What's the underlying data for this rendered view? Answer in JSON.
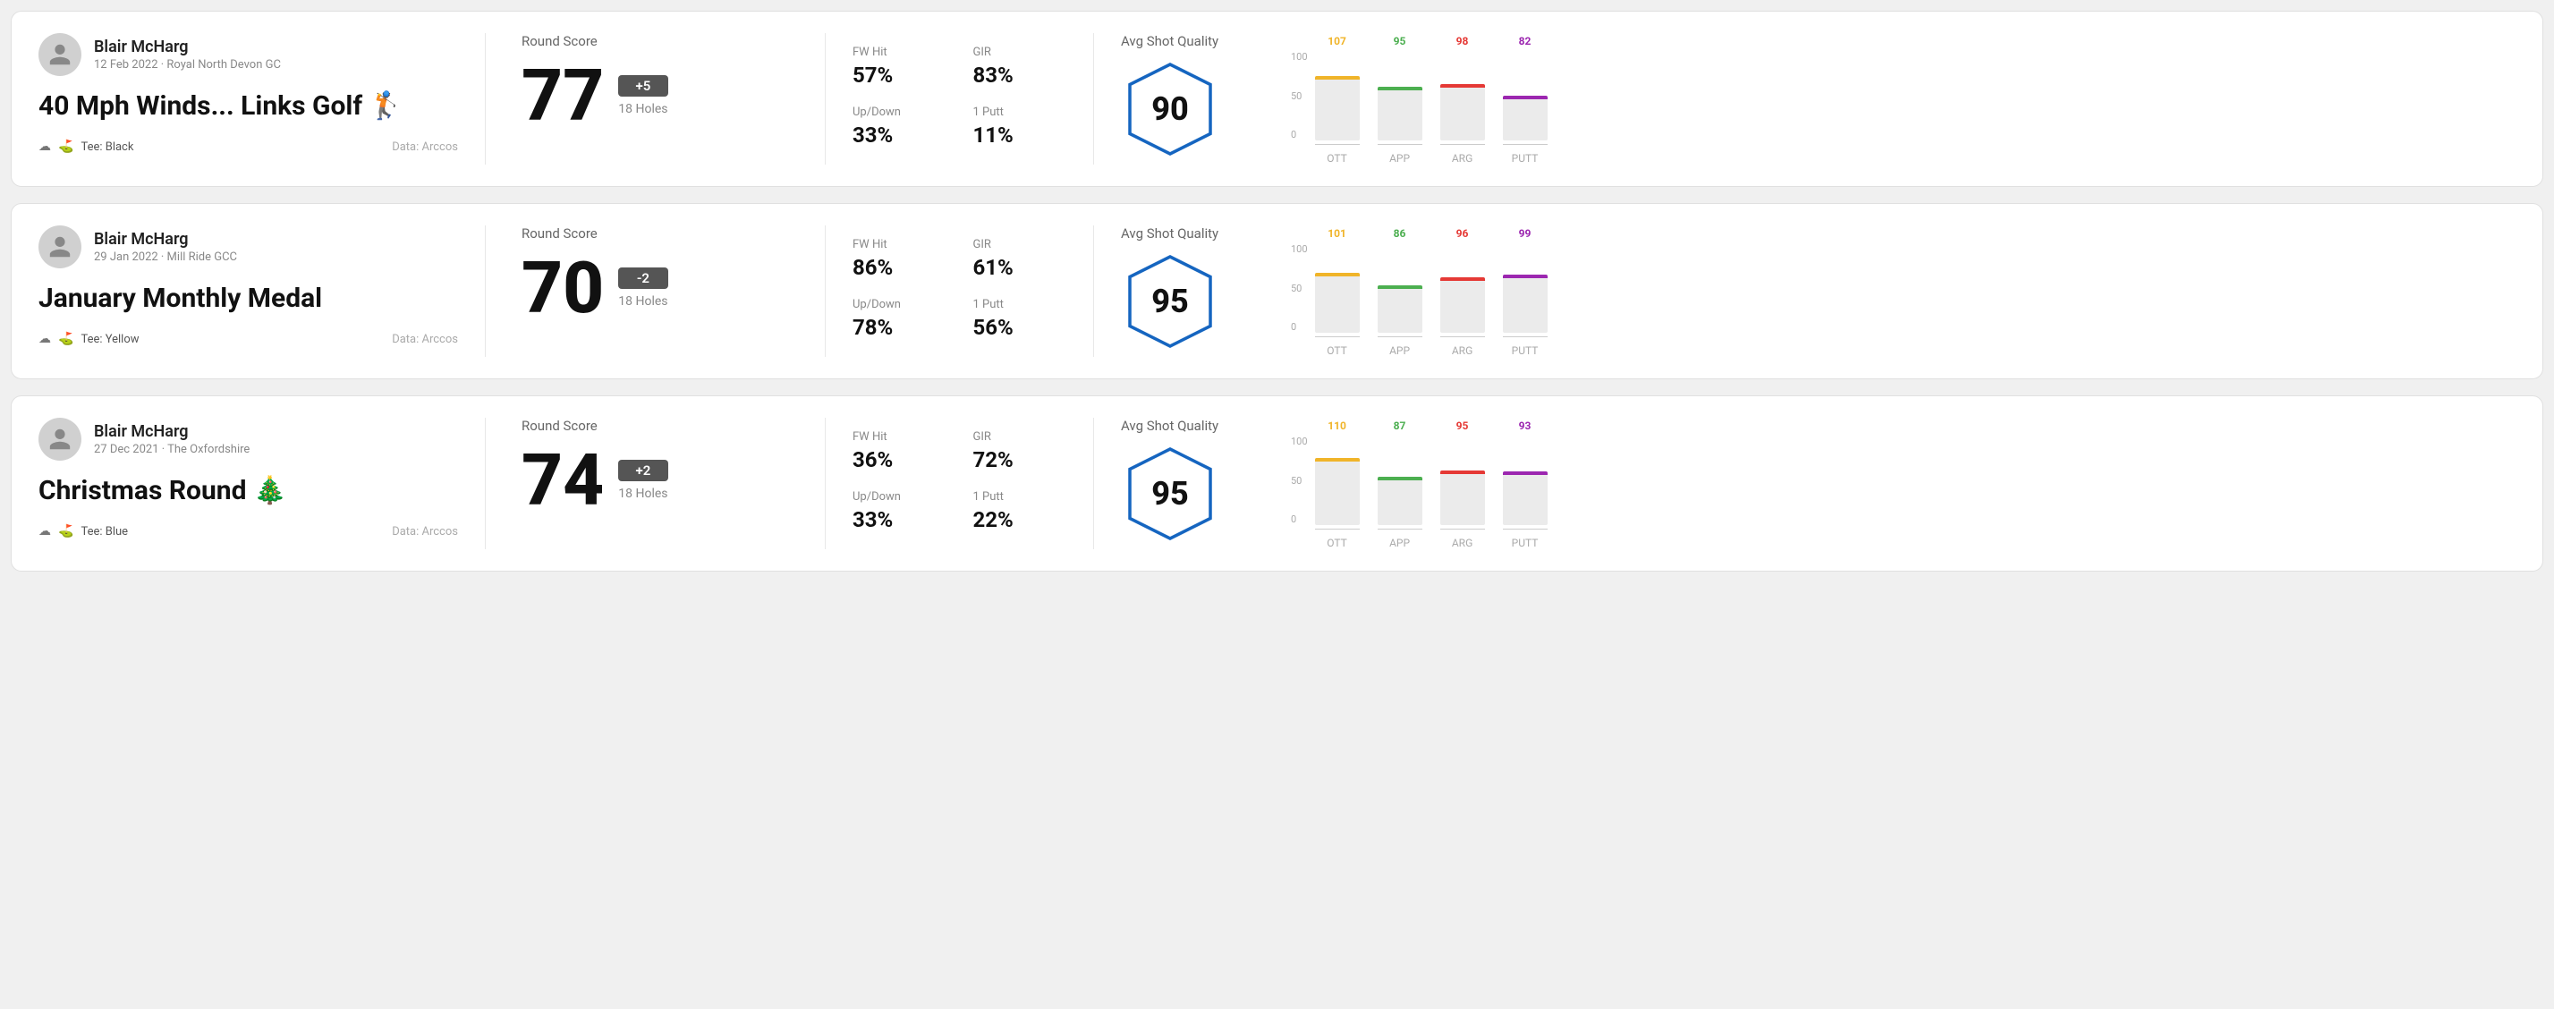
{
  "rounds": [
    {
      "id": "round-1",
      "user": {
        "name": "Blair McHarg",
        "date": "12 Feb 2022 · Royal North Devon GC"
      },
      "title": "40 Mph Winds... Links Golf 🏌",
      "tee": "Black",
      "data_source": "Data: Arccos",
      "score": {
        "value": "77",
        "diff": "+5",
        "holes": "18 Holes"
      },
      "stats": {
        "fw_hit": {
          "label": "FW Hit",
          "value": "57%"
        },
        "gir": {
          "label": "GIR",
          "value": "83%"
        },
        "updown": {
          "label": "Up/Down",
          "value": "33%"
        },
        "one_putt": {
          "label": "1 Putt",
          "value": "11%"
        }
      },
      "avg_shot_quality": {
        "label": "Avg Shot Quality",
        "score": "90"
      },
      "chart": {
        "columns": [
          {
            "label": "OTT",
            "value": 107,
            "color": "#f0b429",
            "bar_height_pct": 72
          },
          {
            "label": "APP",
            "value": 95,
            "color": "#4caf50",
            "bar_height_pct": 60
          },
          {
            "label": "ARG",
            "value": 98,
            "color": "#e53935",
            "bar_height_pct": 63
          },
          {
            "label": "PUTT",
            "value": 82,
            "color": "#9c27b0",
            "bar_height_pct": 50
          }
        ],
        "y_labels": [
          "100",
          "50",
          "0"
        ]
      }
    },
    {
      "id": "round-2",
      "user": {
        "name": "Blair McHarg",
        "date": "29 Jan 2022 · Mill Ride GCC"
      },
      "title": "January Monthly Medal",
      "tee": "Yellow",
      "data_source": "Data: Arccos",
      "score": {
        "value": "70",
        "diff": "-2",
        "holes": "18 Holes"
      },
      "stats": {
        "fw_hit": {
          "label": "FW Hit",
          "value": "86%"
        },
        "gir": {
          "label": "GIR",
          "value": "61%"
        },
        "updown": {
          "label": "Up/Down",
          "value": "78%"
        },
        "one_putt": {
          "label": "1 Putt",
          "value": "56%"
        }
      },
      "avg_shot_quality": {
        "label": "Avg Shot Quality",
        "score": "95"
      },
      "chart": {
        "columns": [
          {
            "label": "OTT",
            "value": 101,
            "color": "#f0b429",
            "bar_height_pct": 67
          },
          {
            "label": "APP",
            "value": 86,
            "color": "#4caf50",
            "bar_height_pct": 53
          },
          {
            "label": "ARG",
            "value": 96,
            "color": "#e53935",
            "bar_height_pct": 62
          },
          {
            "label": "PUTT",
            "value": 99,
            "color": "#9c27b0",
            "bar_height_pct": 65
          }
        ],
        "y_labels": [
          "100",
          "50",
          "0"
        ]
      }
    },
    {
      "id": "round-3",
      "user": {
        "name": "Blair McHarg",
        "date": "27 Dec 2021 · The Oxfordshire"
      },
      "title": "Christmas Round 🎄",
      "tee": "Blue",
      "data_source": "Data: Arccos",
      "score": {
        "value": "74",
        "diff": "+2",
        "holes": "18 Holes"
      },
      "stats": {
        "fw_hit": {
          "label": "FW Hit",
          "value": "36%"
        },
        "gir": {
          "label": "GIR",
          "value": "72%"
        },
        "updown": {
          "label": "Up/Down",
          "value": "33%"
        },
        "one_putt": {
          "label": "1 Putt",
          "value": "22%"
        }
      },
      "avg_shot_quality": {
        "label": "Avg Shot Quality",
        "score": "95"
      },
      "chart": {
        "columns": [
          {
            "label": "OTT",
            "value": 110,
            "color": "#f0b429",
            "bar_height_pct": 75
          },
          {
            "label": "APP",
            "value": 87,
            "color": "#4caf50",
            "bar_height_pct": 54
          },
          {
            "label": "ARG",
            "value": 95,
            "color": "#e53935",
            "bar_height_pct": 61
          },
          {
            "label": "PUTT",
            "value": 93,
            "color": "#9c27b0",
            "bar_height_pct": 60
          }
        ],
        "y_labels": [
          "100",
          "50",
          "0"
        ]
      }
    }
  ],
  "labels": {
    "round_score": "Round Score",
    "avg_shot_quality": "Avg Shot Quality",
    "data_arccos": "Data: Arccos",
    "tee_prefix": "Tee:"
  }
}
